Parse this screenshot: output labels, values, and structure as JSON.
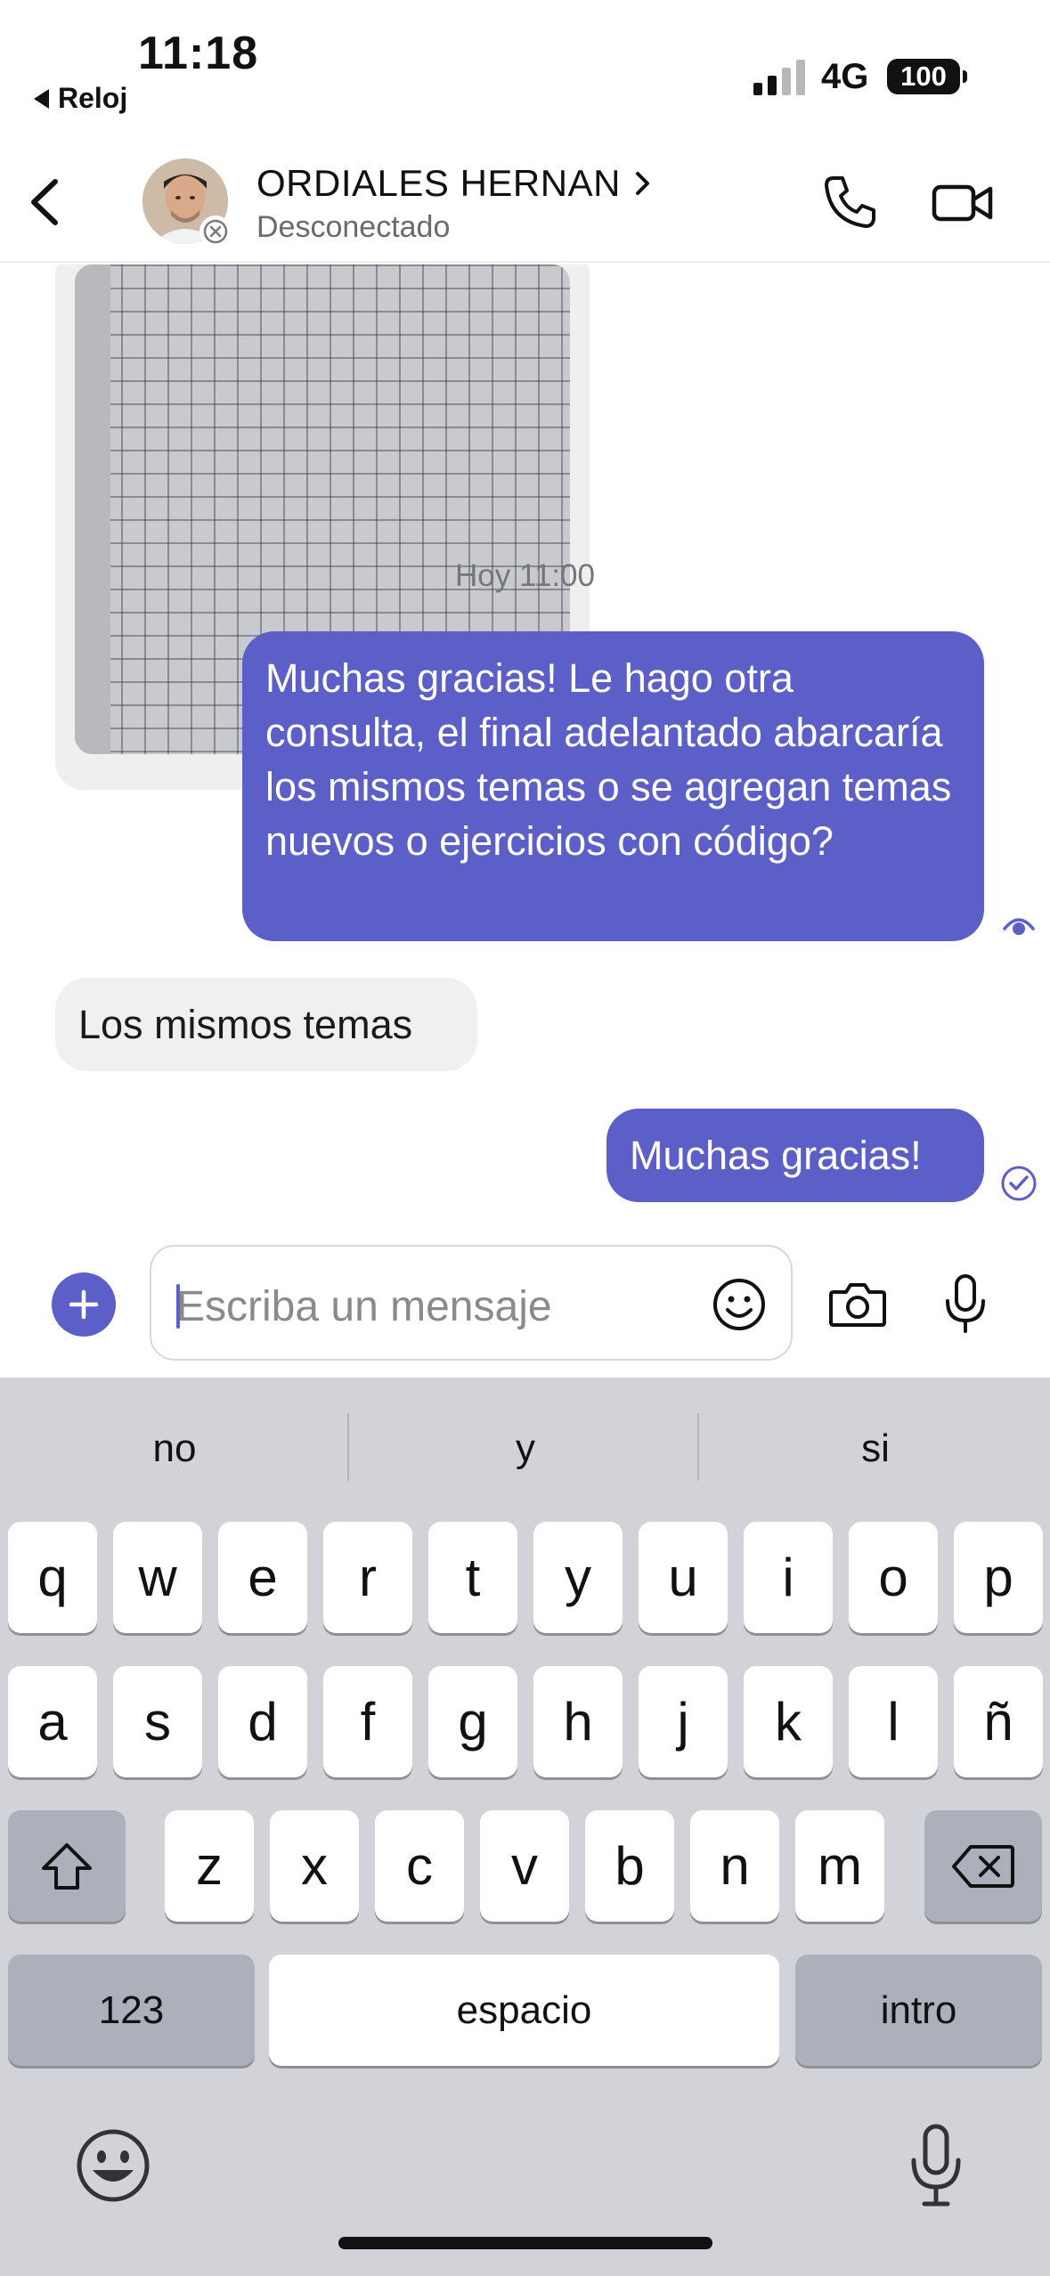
{
  "status_bar": {
    "time": "11:18",
    "back_app": "Reloj",
    "network": "4G",
    "battery": "100"
  },
  "header": {
    "contact_name": "ORDIALES HERNAN",
    "contact_status": "Desconectado",
    "name_chevron": "›"
  },
  "messages": {
    "timestamp": "Hoy 11:00",
    "items": [
      {
        "direction": "out",
        "text": "Muchas gracias! Le hago otra consulta, el final adelantado abarcaría los mismos temas o se agregan temas nuevos o ejercicios con código?",
        "receipt": "seen-icon"
      },
      {
        "direction": "in",
        "text": "Los mismos temas"
      },
      {
        "direction": "out",
        "text": "Muchas gracias!",
        "receipt": "sent-check-icon"
      }
    ]
  },
  "compose": {
    "placeholder": "Escriba un mensaje"
  },
  "keyboard": {
    "suggestions": [
      "no",
      "y",
      "si"
    ],
    "row1": [
      "q",
      "w",
      "e",
      "r",
      "t",
      "y",
      "u",
      "i",
      "o",
      "p"
    ],
    "row2": [
      "a",
      "s",
      "d",
      "f",
      "g",
      "h",
      "j",
      "k",
      "l",
      "ñ"
    ],
    "row3": [
      "z",
      "x",
      "c",
      "v",
      "b",
      "n",
      "m"
    ],
    "numbers_label": "123",
    "space_label": "espacio",
    "return_label": "intro"
  },
  "colors": {
    "accent": "#5b5fc7",
    "outgoing_bubble": "#5b5fc7",
    "incoming_bubble": "#f0f0f0",
    "keyboard_bg": "#d1d3d9"
  }
}
